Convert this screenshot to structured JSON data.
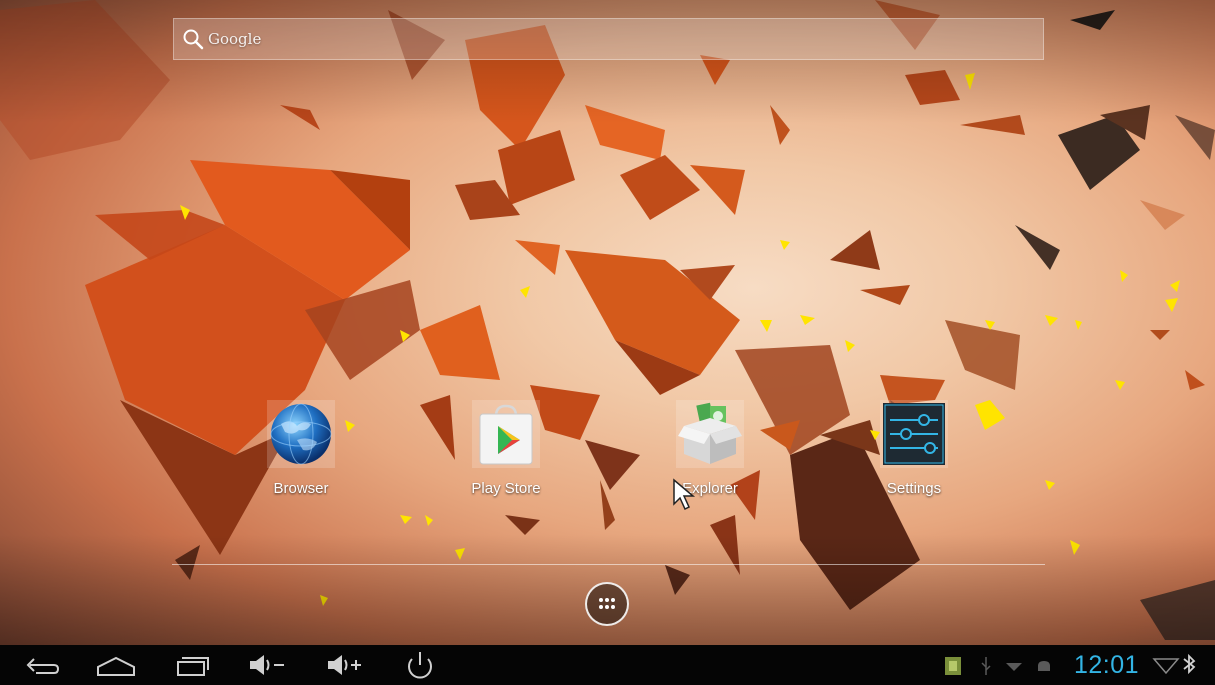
{
  "search": {
    "label": "Google"
  },
  "apps": [
    {
      "label": "Browser"
    },
    {
      "label": "Play Store"
    },
    {
      "label": "Explorer"
    },
    {
      "label": "Settings"
    }
  ],
  "status_bar": {
    "time": "12:01"
  },
  "icons": {
    "search": "magnifier-icon",
    "all_apps": "grid-icon",
    "back": "back-arrow-icon",
    "home": "home-icon",
    "recents": "recent-apps-icon",
    "volume_down": "volume-down-icon",
    "volume_up": "volume-up-icon",
    "power": "power-icon"
  },
  "colors": {
    "clock": "#33b5e5",
    "navbar": "#050505"
  }
}
